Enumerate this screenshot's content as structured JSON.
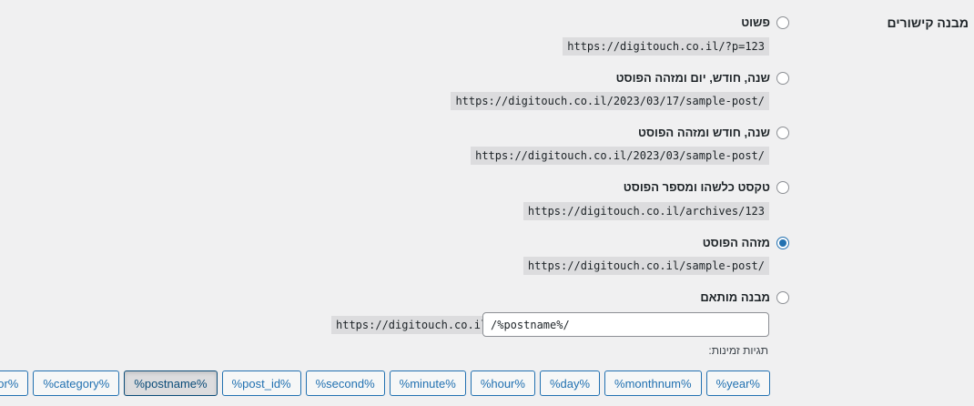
{
  "section_label": "מבנה קישורים",
  "options": [
    {
      "label": "פשוט",
      "example": "https://digitouch.co.il/?p=123",
      "checked": false
    },
    {
      "label": "שנה, חודש, יום ומזהה הפוסט",
      "example": "https://digitouch.co.il/2023/03/17/sample-post/",
      "checked": false
    },
    {
      "label": "שנה, חודש ומזהה הפוסט",
      "example": "https://digitouch.co.il/2023/03/sample-post/",
      "checked": false
    },
    {
      "label": "טקסט כלשהו ומספר הפוסט",
      "example": "https://digitouch.co.il/archives/123",
      "checked": false
    },
    {
      "label": "מזהה הפוסט",
      "example": "https://digitouch.co.il/sample-post/",
      "checked": true
    },
    {
      "label": "מבנה מותאם",
      "checked": false
    }
  ],
  "custom": {
    "prefix": "https://digitouch.co.il",
    "value": "/%postname%/"
  },
  "tags_label": "תגיות זמינות:",
  "tags": [
    {
      "label": "%year%",
      "active": false
    },
    {
      "label": "%monthnum%",
      "active": false
    },
    {
      "label": "%day%",
      "active": false
    },
    {
      "label": "%hour%",
      "active": false
    },
    {
      "label": "%minute%",
      "active": false
    },
    {
      "label": "%second%",
      "active": false
    },
    {
      "label": "%post_id%",
      "active": false
    },
    {
      "label": "%postname%",
      "active": true
    },
    {
      "label": "%category%",
      "active": false
    },
    {
      "label": "%author%",
      "active": false
    }
  ],
  "colors": {
    "accent": "#2271b1",
    "code_bg": "#dcdcde",
    "page_bg": "#f0f0f1"
  }
}
